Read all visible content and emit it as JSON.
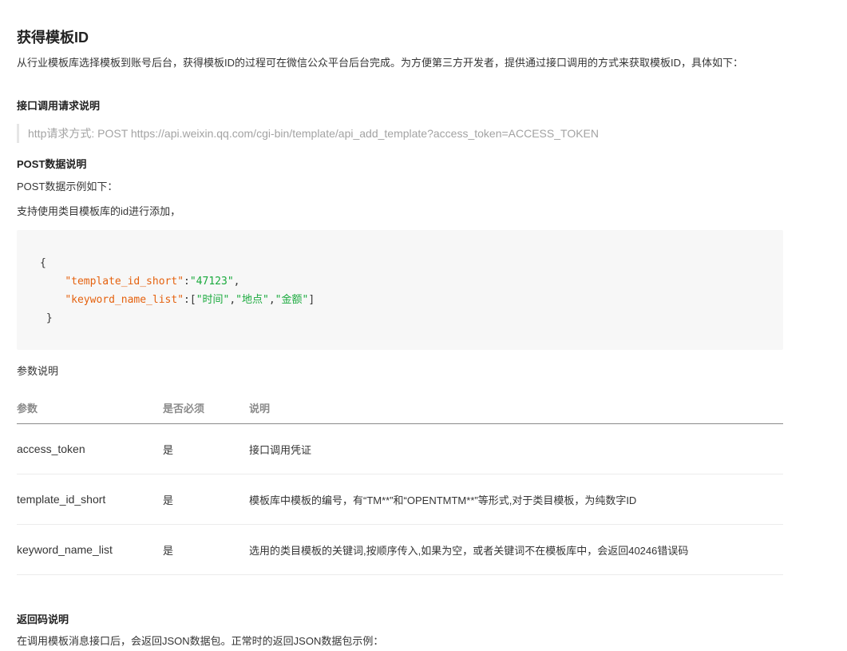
{
  "title": "获得模板ID",
  "intro": "从行业模板库选择模板到账号后台，获得模板ID的过程可在微信公众平台后台完成。为方便第三方开发者，提供通过接口调用的方式来获取模板ID，具体如下：",
  "request_heading": "接口调用请求说明",
  "request_line": "http请求方式: POST https://api.weixin.qq.com/cgi-bin/template/api_add_template?access_token=ACCESS_TOKEN",
  "post_heading": "POST数据说明",
  "post_example_text": "POST数据示例如下：",
  "support_text": "支持使用类目模板库的id进行添加，",
  "code": {
    "open_brace": "{",
    "close_brace": "}",
    "key1": "\"template_id_short\"",
    "val1": "\"47123\"",
    "key2": "\"keyword_name_list\"",
    "val2a": "\"时间\"",
    "val2b": "\"地点\"",
    "val2c": "\"金额\""
  },
  "param_heading": "参数说明",
  "table": {
    "headers": [
      "参数",
      "是否必须",
      "说明"
    ],
    "rows": [
      [
        "access_token",
        "是",
        "接口调用凭证"
      ],
      [
        "template_id_short",
        "是",
        "模板库中模板的编号，有“TM**”和“OPENTMTM**”等形式,对于类目模板，为纯数字ID"
      ],
      [
        "keyword_name_list",
        "是",
        "选用的类目模板的关键词,按顺序传入,如果为空，或者关键词不在模板库中，会返回40246错误码"
      ]
    ]
  },
  "return_heading": "返回码说明",
  "return_text": "在调用模板消息接口后，会返回JSON数据包。正常时的返回JSON数据包示例："
}
